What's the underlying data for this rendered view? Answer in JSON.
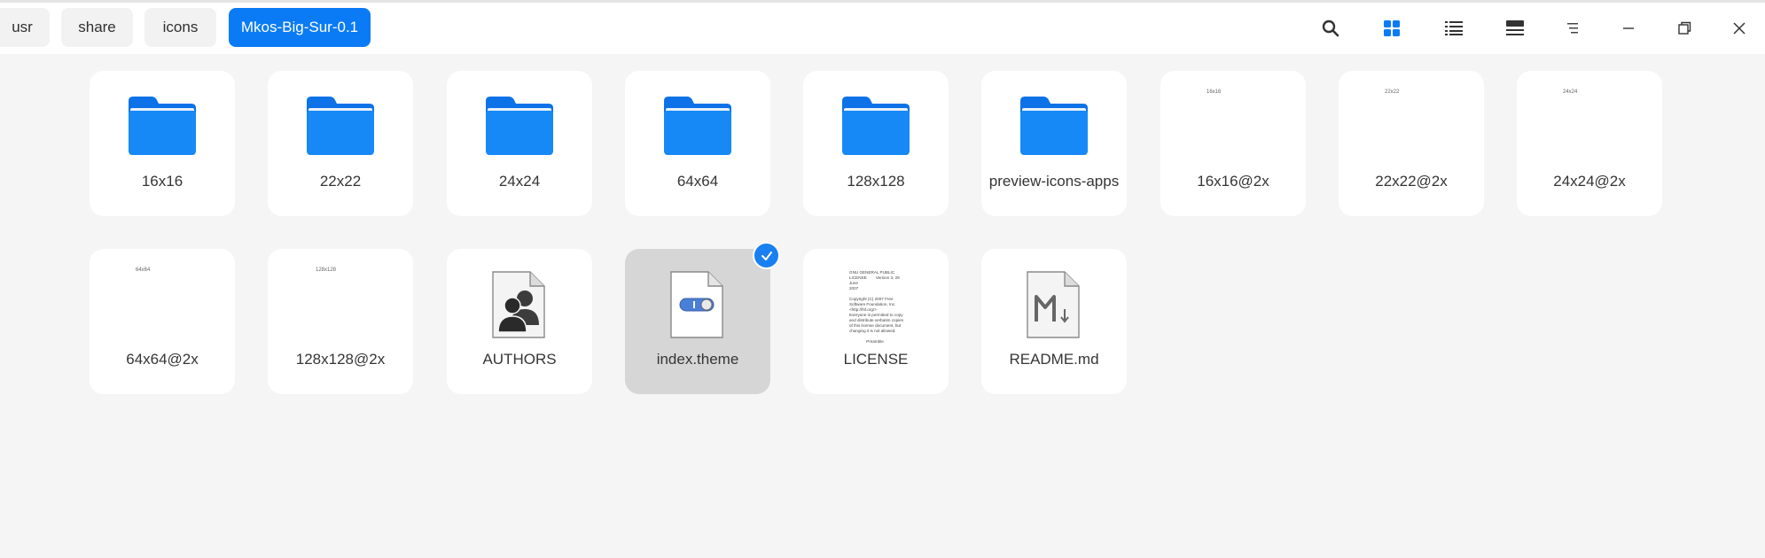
{
  "breadcrumbs": [
    "usr",
    "share",
    "icons",
    "Mkos-Big-Sur-0.1"
  ],
  "toolbar": {
    "icons": [
      "search-icon",
      "grid-view-icon",
      "list-view-icon",
      "split-view-icon",
      "menu-icon",
      "minimize-icon",
      "restore-icon",
      "close-icon"
    ],
    "accent_color": "#0a7bf5"
  },
  "files": [
    {
      "name": "16x16",
      "type": "folder"
    },
    {
      "name": "22x22",
      "type": "folder"
    },
    {
      "name": "24x24",
      "type": "folder"
    },
    {
      "name": "64x64",
      "type": "folder"
    },
    {
      "name": "128x128",
      "type": "folder"
    },
    {
      "name": "preview-icons-apps",
      "type": "folder"
    },
    {
      "name": "16x16@2x",
      "type": "folder",
      "thumb_text": "16x16"
    },
    {
      "name": "22x22@2x",
      "type": "folder",
      "thumb_text": "22x22"
    },
    {
      "name": "24x24@2x",
      "type": "folder",
      "thumb_text": "24x24"
    },
    {
      "name": "64x64@2x",
      "type": "folder",
      "thumb_text": "64x64"
    },
    {
      "name": "128x128@2x",
      "type": "folder",
      "thumb_text": "128x128"
    },
    {
      "name": "AUTHORS",
      "type": "file",
      "icon": "authors-icon"
    },
    {
      "name": "index.theme",
      "type": "file",
      "icon": "theme-settings-icon",
      "selected": true
    },
    {
      "name": "LICENSE",
      "type": "file",
      "icon": "text-preview",
      "preview_text": "GNU GENERAL PUBLIC\nLICENSE        Version 3, 29 June\n2007\n\nCopyright (C) 2007 Free\nSoftware Foundation, Inc.\n<http://fsf.org/>\nEveryone is permitted to copy\nand distribute verbatim copies\nof this license document, but\nchanging it is not allowed.\n\n               Preamble"
    },
    {
      "name": "README.md",
      "type": "file",
      "icon": "markdown-icon"
    }
  ]
}
